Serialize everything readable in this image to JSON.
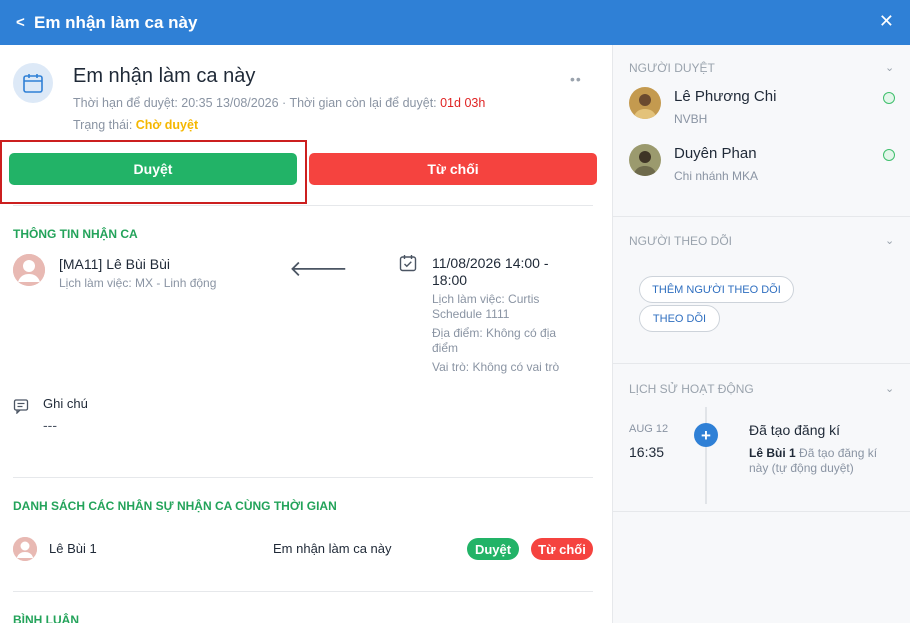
{
  "header": {
    "back_icon": "chevron-left-icon",
    "title": "Em nhận làm ca này",
    "close_icon": "close-icon"
  },
  "request": {
    "title": "Em nhận làm ca này",
    "deadline_label": "Thời hạn để duyệt: 20:35 13/08/2026 · Thời gian còn lại để duyệt: ",
    "remaining": "01d 03h",
    "status_label": "Trạng thái: ",
    "status_value": "Chờ duyệt",
    "approve_label": "Duyệt",
    "reject_label": "Từ chối"
  },
  "shift_info": {
    "section_title": "THÔNG TIN NHẬN CA",
    "employee_name": "[MA11] Lê Bùi Bùi",
    "employee_schedule": "Lịch làm việc: MX - Linh động",
    "shift_time": "11/08/2026 14:00 - 18:00",
    "shift_schedule": "Lịch làm việc: Curtis Schedule 1111",
    "shift_location": "Địa điểm: Không có địa điểm",
    "shift_role": "Vai trò: Không có vai trò",
    "note_label": "Ghi chú",
    "note_value": "---"
  },
  "same_time_list": {
    "section_title": "DANH SÁCH CÁC NHÂN SỰ NHẬN CA CÙNG THỜI GIAN",
    "rows": [
      {
        "name": "Lê Bùi 1",
        "request": "Em nhận làm ca này",
        "approve": "Duyệt",
        "reject": "Từ chối"
      }
    ]
  },
  "comments": {
    "section_title": "BÌNH LUẬN"
  },
  "sidebar": {
    "approvers_title": "NGƯỜI DUYỆT",
    "approvers": [
      {
        "name": "Lê Phương Chi",
        "sub": "NVBH"
      },
      {
        "name": "Duyên Phan",
        "sub": "Chi nhánh MKA"
      }
    ],
    "followers_title": "NGƯỜI THEO DÕI",
    "add_follower": "THÊM NGƯỜI THEO DÕI",
    "follow": "THEO DÕI",
    "history_title": "LỊCH SỬ HOẠT ĐỘNG",
    "history": {
      "month": "AUG 12",
      "time": "16:35",
      "action": "Đã tạo đăng kí",
      "actor": "Lê Bùi 1",
      "detail": " Đã tạo đăng kí này (tự động duyệt)"
    }
  },
  "colors": {
    "header_blue": "#2f80d6",
    "approve_green": "#22b367",
    "reject_red": "#f5433f",
    "section_green": "#23a35a",
    "status_yellow": "#f5b700",
    "highlight_border": "#cc1f1f"
  }
}
